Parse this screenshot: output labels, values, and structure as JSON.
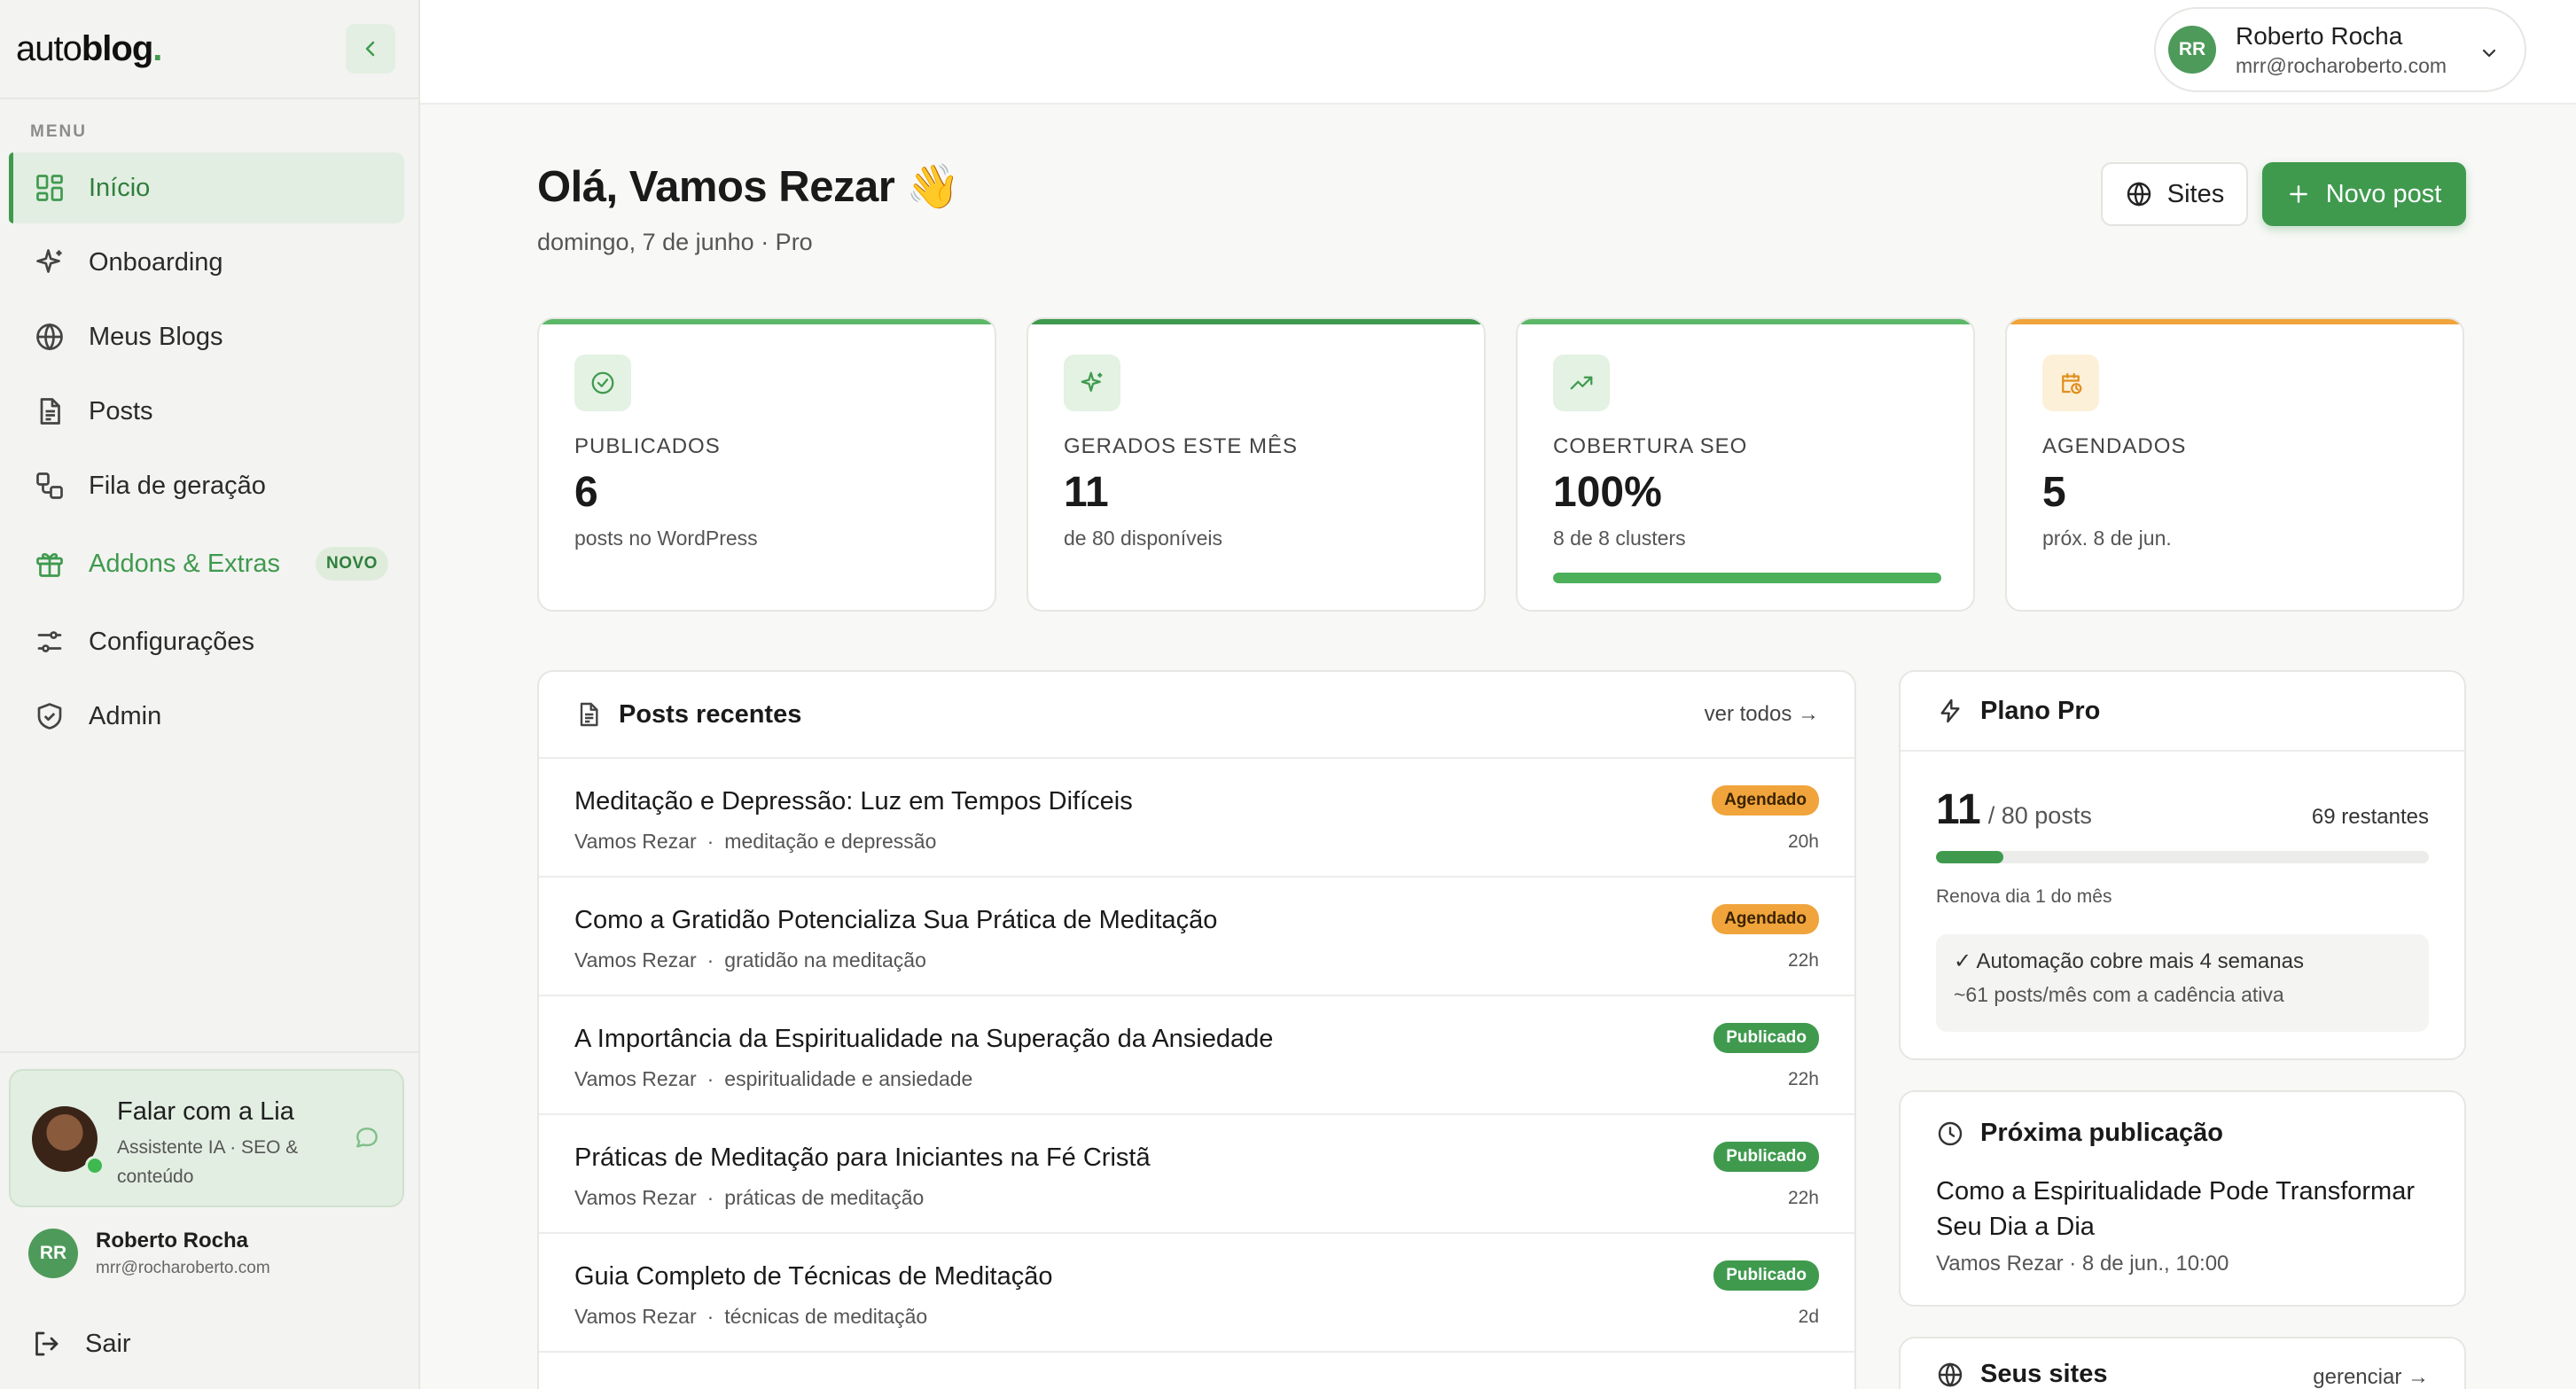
{
  "sidebar": {
    "logo_prefix": "auto",
    "logo_bold": "blog",
    "logo_dot": ".",
    "menu_label": "MENU",
    "items": [
      {
        "label": "Início",
        "icon": "grid-icon"
      },
      {
        "label": "Onboarding",
        "icon": "sparkles-icon"
      },
      {
        "label": "Meus Blogs",
        "icon": "globe-icon"
      },
      {
        "label": "Posts",
        "icon": "document-icon"
      },
      {
        "label": "Fila de geração",
        "icon": "queue-icon"
      },
      {
        "label": "Addons & Extras",
        "icon": "gift-icon",
        "badge": "NOVO"
      },
      {
        "label": "Configurações",
        "icon": "sliders-icon"
      },
      {
        "label": "Admin",
        "icon": "shield-icon"
      }
    ],
    "assistant": {
      "title": "Falar com a Lia",
      "subtitle": "Assistente IA · SEO & conteúdo"
    },
    "user": {
      "initials": "RR",
      "name": "Roberto Rocha",
      "email": "mrr@rocharoberto.com"
    },
    "logout_label": "Sair"
  },
  "topbar": {
    "user": {
      "initials": "RR",
      "name": "Roberto Rocha",
      "email": "mrr@rocharoberto.com"
    }
  },
  "header": {
    "greeting": "Olá, Vamos Rezar 👋",
    "subtitle": "domingo, 7 de junho · Pro",
    "sites_button": "Sites",
    "new_post_button": "Novo post"
  },
  "stats": [
    {
      "label": "PUBLICADOS",
      "value": "6",
      "sub": "posts no WordPress",
      "color": "#5cb868"
    },
    {
      "label": "GERADOS ESTE MÊS",
      "value": "11",
      "sub": "de 80 disponíveis",
      "color": "#3f9a4e"
    },
    {
      "label": "COBERTURA SEO",
      "value": "100%",
      "sub": "8 de 8 clusters",
      "color": "#5cb868",
      "progress": 1.0
    },
    {
      "label": "AGENDADOS",
      "value": "5",
      "sub": "próx. 8 de jun.",
      "color": "#f0a43b"
    }
  ],
  "recent_posts": {
    "title": "Posts recentes",
    "see_all": "ver todos →",
    "posts": [
      {
        "title": "Meditação e Depressão: Luz em Tempos Difíceis",
        "blog": "Vamos Rezar",
        "sep": "·",
        "keyword": "meditação e depressão",
        "status": "Agendado",
        "time": "20h"
      },
      {
        "title": "Como a Gratidão Potencializa Sua Prática de Meditação",
        "blog": "Vamos Rezar",
        "sep": "·",
        "keyword": "gratidão na meditação",
        "status": "Agendado",
        "time": "22h"
      },
      {
        "title": "A Importância da Espiritualidade na Superação da Ansiedade",
        "blog": "Vamos Rezar",
        "sep": "·",
        "keyword": "espiritualidade e ansiedade",
        "status": "Publicado",
        "time": "22h"
      },
      {
        "title": "Práticas de Meditação para Iniciantes na Fé Cristã",
        "blog": "Vamos Rezar",
        "sep": "·",
        "keyword": "práticas de meditação",
        "status": "Publicado",
        "time": "22h"
      },
      {
        "title": "Guia Completo de Técnicas de Meditação",
        "blog": "Vamos Rezar",
        "sep": "·",
        "keyword": "técnicas de meditação",
        "status": "Publicado",
        "time": "2d"
      }
    ]
  },
  "plan": {
    "title": "Plano Pro",
    "used": "11",
    "total_label": "/ 80 posts",
    "remaining": "69 restantes",
    "progress": 0.1375,
    "renew": "Renova dia 1 do mês",
    "automation_line1": "✓ Automação cobre mais 4 semanas",
    "automation_line2": "~61 posts/mês com a cadência ativa"
  },
  "next_publication": {
    "title": "Próxima publicação",
    "post_title": "Como a Espiritualidade Pode Transformar Seu Dia a Dia",
    "meta": "Vamos Rezar · 8 de jun., 10:00"
  },
  "sites": {
    "title": "Seus sites",
    "manage": "gerenciar →"
  }
}
